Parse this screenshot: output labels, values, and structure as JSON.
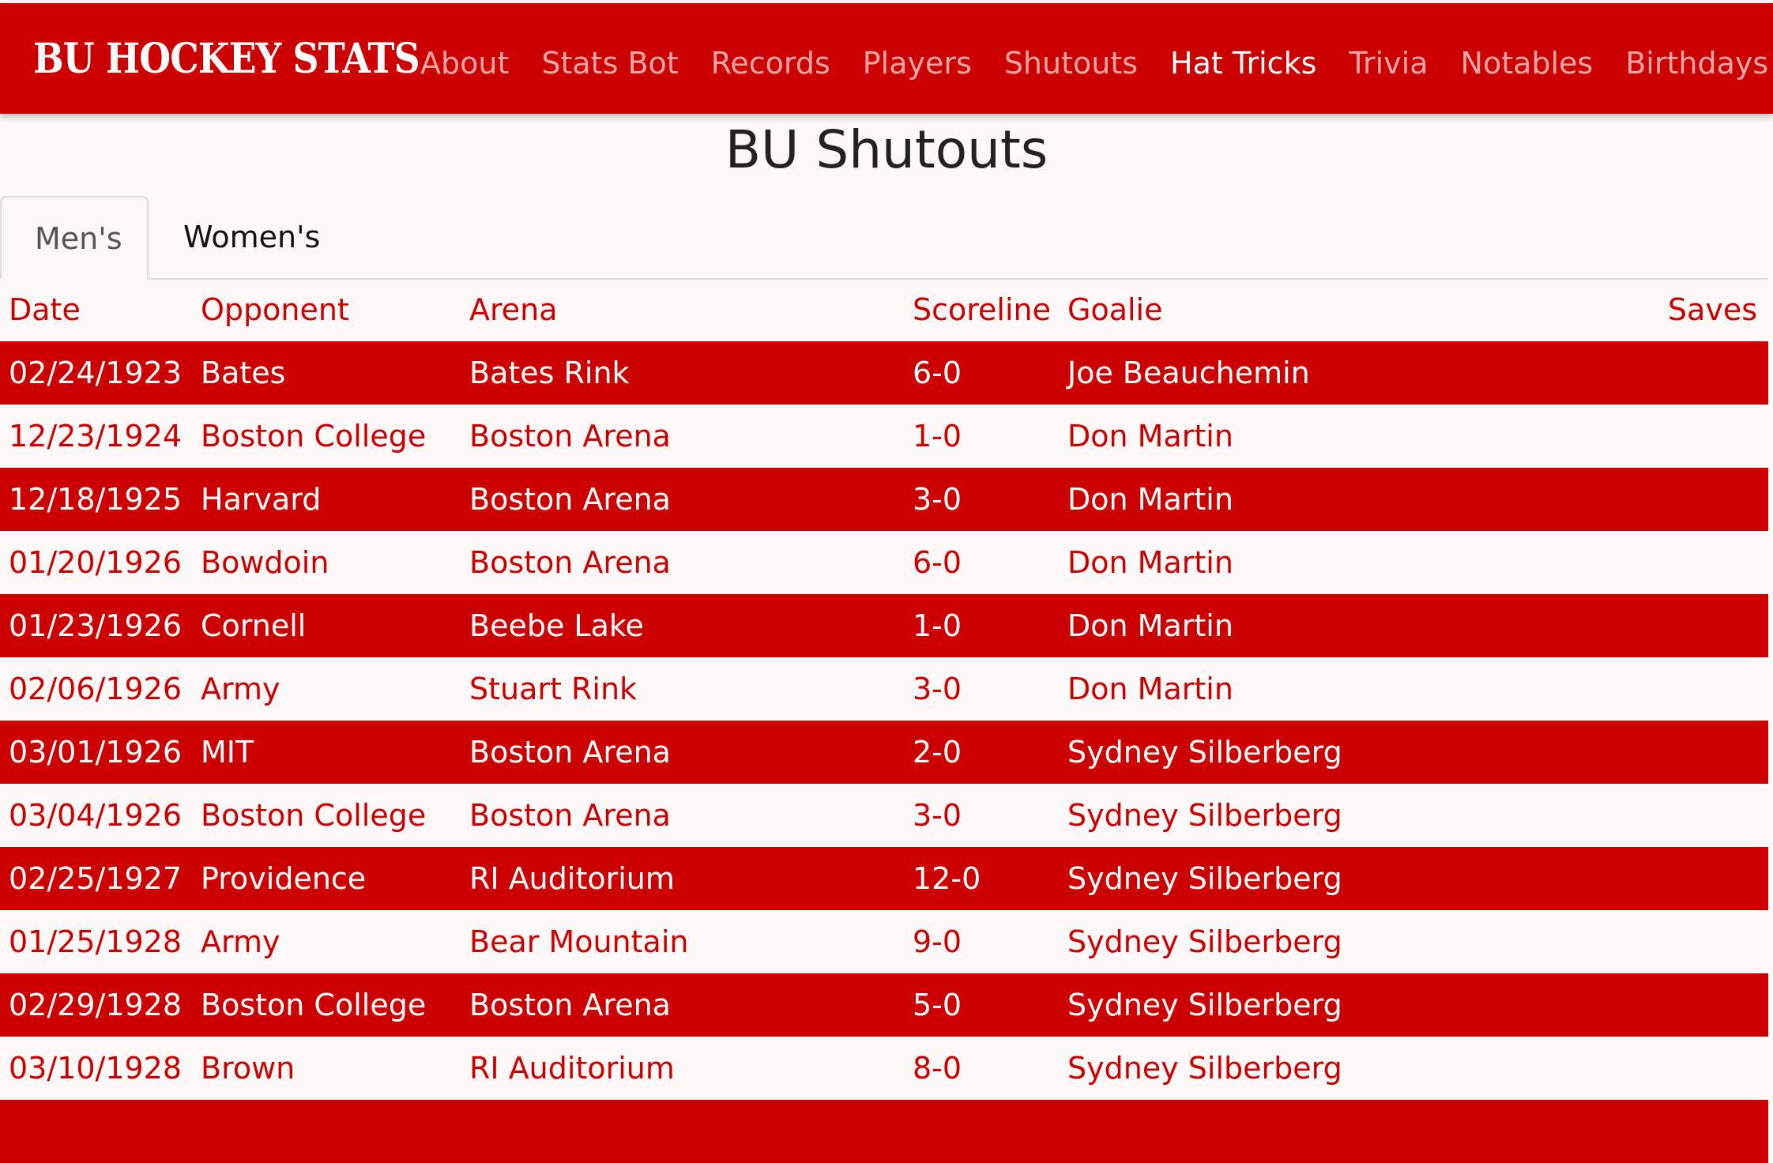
{
  "navbar": {
    "brand": "BU HOCKEY STATS",
    "links": [
      "About",
      "Stats Bot",
      "Records",
      "Players",
      "Shutouts",
      "Hat Tricks",
      "Trivia",
      "Notables",
      "Birthdays"
    ]
  },
  "page_title": "BU Shutouts",
  "tabs": [
    "Men's",
    "Women's"
  ],
  "table": {
    "columns": [
      "Date",
      "Opponent",
      "Arena",
      "Scoreline",
      "Goalie",
      "Saves"
    ],
    "rows": [
      [
        "02/24/1923",
        "Bates",
        "Bates Rink",
        "6-0",
        "Joe Beauchemin",
        ""
      ],
      [
        "12/23/1924",
        "Boston College",
        "Boston Arena",
        "1-0",
        "Don Martin",
        ""
      ],
      [
        "12/18/1925",
        "Harvard",
        "Boston Arena",
        "3-0",
        "Don Martin",
        ""
      ],
      [
        "01/20/1926",
        "Bowdoin",
        "Boston Arena",
        "6-0",
        "Don Martin",
        ""
      ],
      [
        "01/23/1926",
        "Cornell",
        "Beebe Lake",
        "1-0",
        "Don Martin",
        ""
      ],
      [
        "02/06/1926",
        "Army",
        "Stuart Rink",
        "3-0",
        "Don Martin",
        ""
      ],
      [
        "03/01/1926",
        "MIT",
        "Boston Arena",
        "2-0",
        "Sydney Silberberg",
        ""
      ],
      [
        "03/04/1926",
        "Boston College",
        "Boston Arena",
        "3-0",
        "Sydney Silberberg",
        ""
      ],
      [
        "02/25/1927",
        "Providence",
        "RI Auditorium",
        "12-0",
        "Sydney Silberberg",
        ""
      ],
      [
        "01/25/1928",
        "Army",
        "Bear Mountain",
        "9-0",
        "Sydney Silberberg",
        ""
      ],
      [
        "02/29/1928",
        "Boston College",
        "Boston Arena",
        "5-0",
        "Sydney Silberberg",
        ""
      ],
      [
        "03/10/1928",
        "Brown",
        "RI Auditorium",
        "8-0",
        "Sydney Silberberg",
        ""
      ],
      [
        "",
        "",
        "",
        "",
        "",
        ""
      ]
    ]
  },
  "colors": {
    "brand_red": "#cc0000",
    "background": "#fcf8f8",
    "nav_link": "#f0a6a6",
    "nav_link_active": "#ffffff"
  }
}
